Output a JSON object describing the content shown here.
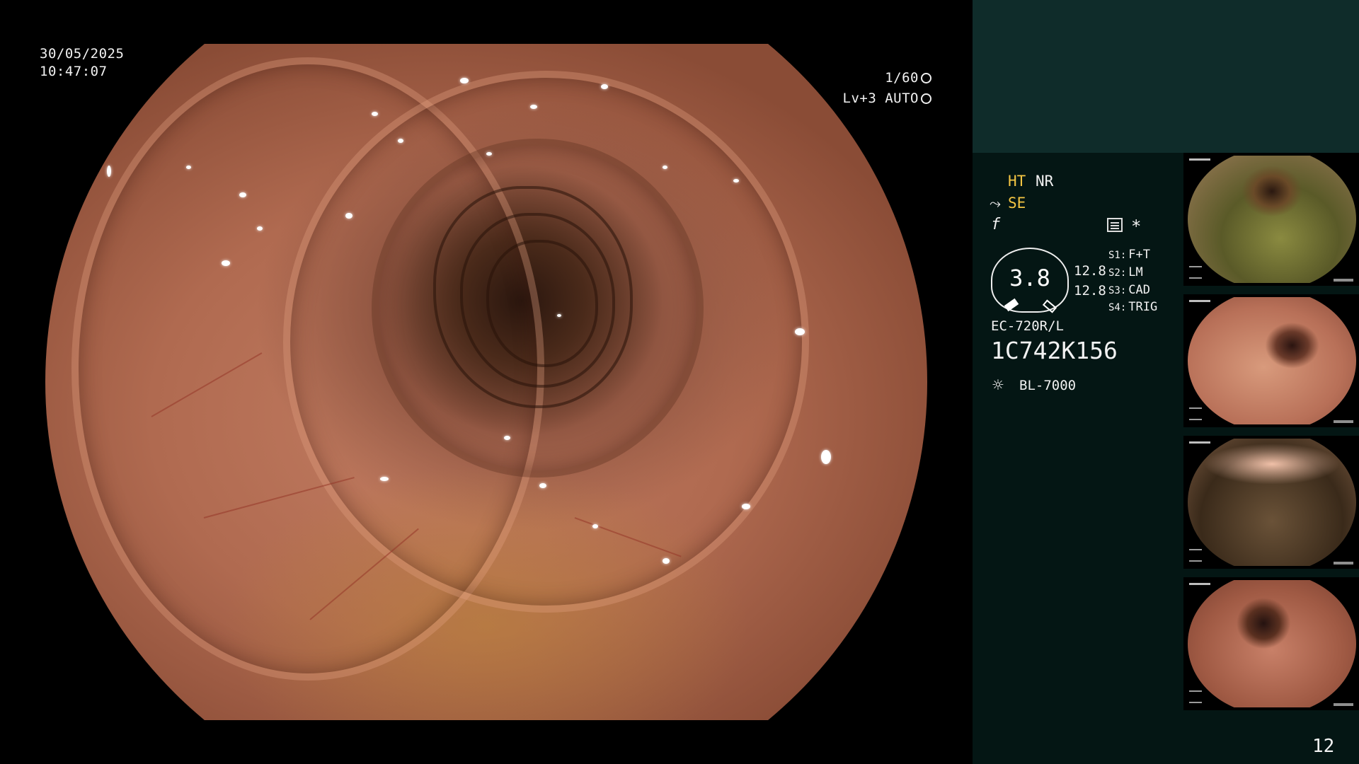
{
  "overlay": {
    "date": "30/05/2025",
    "time": "10:47:07",
    "shutter": "1/60",
    "exposure": "Lv+3 AUTO"
  },
  "panel": {
    "ht": "HT",
    "nr": "NR",
    "se": "SE",
    "asterisk": "*",
    "gauge_value": "3.8",
    "gauge_reading_1": "12.8",
    "gauge_reading_2": "12.8",
    "switches": [
      {
        "label": "S1:",
        "value": "F+T"
      },
      {
        "label": "S2:",
        "value": "LM"
      },
      {
        "label": "S3:",
        "value": "CAD"
      },
      {
        "label": "S4:",
        "value": "TRIG"
      }
    ],
    "scope_model": "EC-720R/L",
    "scope_serial": "1C742K156",
    "light_source": "BL-7000",
    "page_number": "12"
  },
  "colors": {
    "panel_bg": "#041614",
    "panel_header_bg": "#0f2c2a",
    "highlight_yellow": "#f4c543"
  },
  "icons": [
    "shutter-icon",
    "exposure-icon",
    "structure-enhance-icon",
    "color-mode-icon",
    "menu-icon",
    "light-source-icon"
  ]
}
